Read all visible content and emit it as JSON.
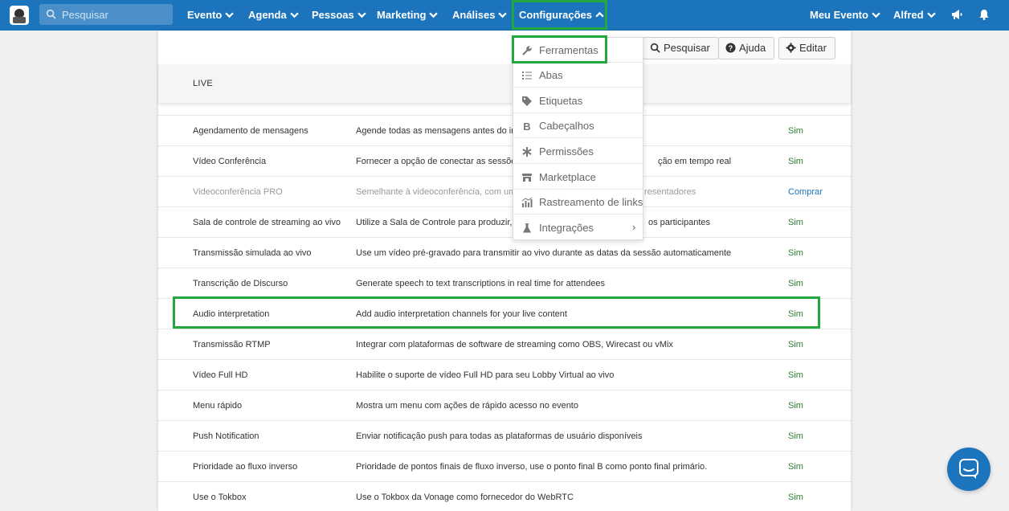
{
  "nav": {
    "search_placeholder": "Pesquisar",
    "items": [
      "Evento",
      "Agenda",
      "Pessoas",
      "Marketing",
      "Análises",
      "Configurações"
    ],
    "event_menu": "Meu Evento",
    "user_menu": "Alfred"
  },
  "toolbar": {
    "search_label": "Pesquisar",
    "help_label": "Ajuda",
    "edit_label": "Editar"
  },
  "section": {
    "title": "LIVE"
  },
  "rows": [
    {
      "name": "Agendamento de mensagens",
      "desc": "Agende todas as mensagens antes do início",
      "status": "Sim"
    },
    {
      "name": "Vídeo Conferência",
      "desc": "Fornecer a opção de conectar as sessões",
      "desc_tail": "ção em tempo real",
      "status": "Sim"
    },
    {
      "name": "Videoconferência PRO",
      "desc": "Semelhante à videoconferência, com uma",
      "desc_tail": "resentadores",
      "status": "Comprar"
    },
    {
      "name": "Sala de controle de streaming ao vivo",
      "desc": "Utilize a Sala de Controle para produzir, e",
      "desc_tail": "os participantes",
      "status": "Sim"
    },
    {
      "name": "Transmissão simulada ao vivo",
      "desc": "Use um vídeo pré-gravado para transmitir ao vivo durante as datas da sessão automaticamente",
      "status": "Sim"
    },
    {
      "name": "Transcrição de Discurso",
      "desc": "Generate speech to text transcriptions in real time for attendees",
      "status": "Sim"
    },
    {
      "name": "Audio interpretation",
      "desc": "Add audio interpretation channels for your live content",
      "status": "Sim"
    },
    {
      "name": "Transmissão RTMP",
      "desc": "Integrar com plataformas de software de streaming como OBS, Wirecast ou vMix",
      "status": "Sim"
    },
    {
      "name": "Vídeo Full HD",
      "desc": "Habilite o suporte de vídeo Full HD para seu Lobby Virtual ao vivo",
      "status": "Sim"
    },
    {
      "name": "Menu rápido",
      "desc": "Mostra um menu com ações de rápido acesso no evento",
      "status": "Sim"
    },
    {
      "name": "Push Notification",
      "desc": "Enviar notificação push para todas as plataformas de usuário disponíveis",
      "status": "Sim"
    },
    {
      "name": "Prioridade ao fluxo inverso",
      "desc": "Prioridade de pontos finais de fluxo inverso, use o ponto final B como ponto final primário.",
      "status": "Sim"
    },
    {
      "name": "Use o Tokbox",
      "desc": "Use o Tokbox da Vonage como fornecedor do WebRTC",
      "status": "Sim"
    }
  ],
  "dropdown": {
    "items": [
      "Ferramentas",
      "Abas",
      "Etiquetas",
      "Cabeçalhos",
      "Permissões",
      "Marketplace",
      "Rastreamento de links",
      "Integrações"
    ]
  },
  "colors": {
    "brand": "#1c75bc",
    "highlight": "#22a83d",
    "status_yes": "#2e7d32"
  }
}
